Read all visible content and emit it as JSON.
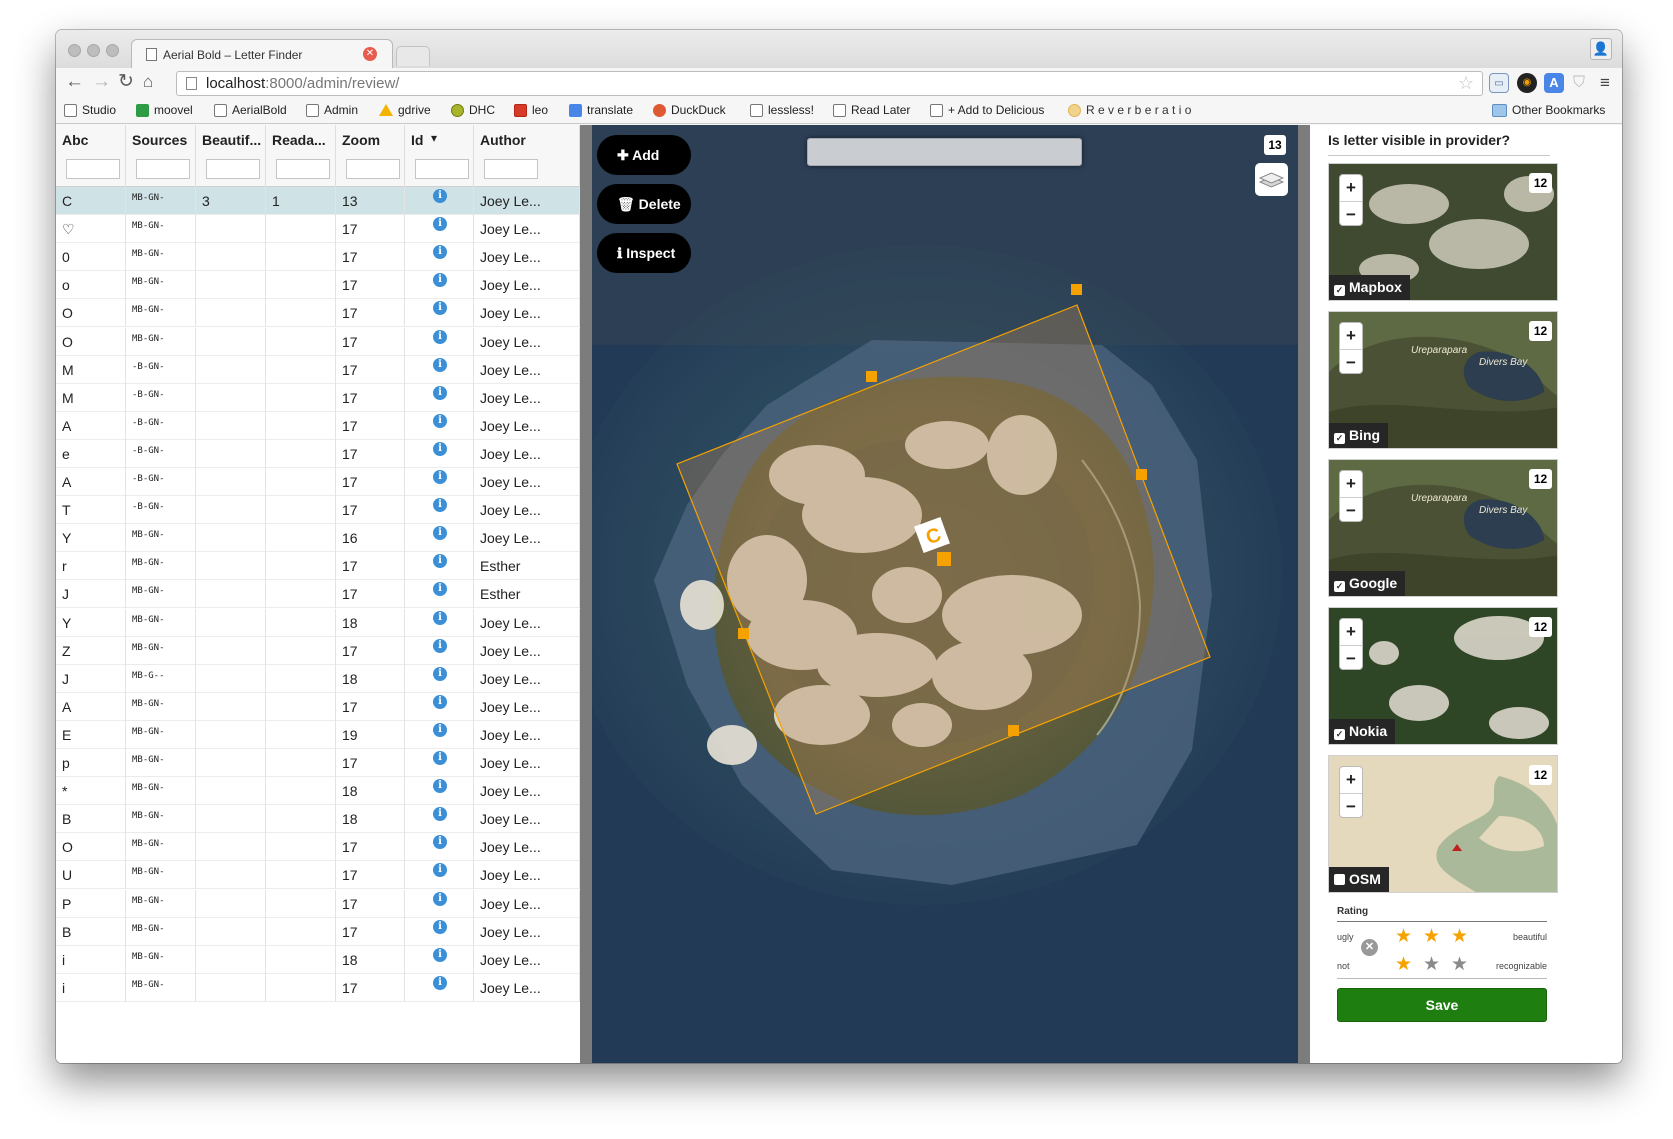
{
  "browser": {
    "tab_title": "Aerial Bold – Letter Finder",
    "url_host": "localhost",
    "url_rest": ":8000/admin/review/",
    "bookmarks": [
      "Studio",
      "moovel",
      "AerialBold",
      "Admin",
      "gdrive",
      "DHC",
      "leo",
      "translate",
      "DuckDuck",
      "lessless!",
      "Read Later",
      "+ Add to Delicious",
      "R e v e r b e r a t i o"
    ],
    "other_bookmarks": "Other Bookmarks"
  },
  "table": {
    "columns": [
      "Abc",
      "Sources",
      "Beautif...",
      "Reada...",
      "Zoom",
      "Id",
      "Author"
    ],
    "rows": [
      {
        "abc": "C",
        "src": "MB-GN-",
        "beautiful": "3",
        "readable": "1",
        "zoom": "13",
        "author": "Joey Le..."
      },
      {
        "abc": "♡",
        "src": "MB-GN-",
        "beautiful": "",
        "readable": "",
        "zoom": "17",
        "author": "Joey Le..."
      },
      {
        "abc": "0",
        "src": "MB-GN-",
        "beautiful": "",
        "readable": "",
        "zoom": "17",
        "author": "Joey Le..."
      },
      {
        "abc": "o",
        "src": "MB-GN-",
        "beautiful": "",
        "readable": "",
        "zoom": "17",
        "author": "Joey Le..."
      },
      {
        "abc": "O",
        "src": "MB-GN-",
        "beautiful": "",
        "readable": "",
        "zoom": "17",
        "author": "Joey Le..."
      },
      {
        "abc": "O",
        "src": "MB-GN-",
        "beautiful": "",
        "readable": "",
        "zoom": "17",
        "author": "Joey Le..."
      },
      {
        "abc": "M",
        "src": "-B-GN-",
        "beautiful": "",
        "readable": "",
        "zoom": "17",
        "author": "Joey Le..."
      },
      {
        "abc": "M",
        "src": "-B-GN-",
        "beautiful": "",
        "readable": "",
        "zoom": "17",
        "author": "Joey Le..."
      },
      {
        "abc": "A",
        "src": "-B-GN-",
        "beautiful": "",
        "readable": "",
        "zoom": "17",
        "author": "Joey Le..."
      },
      {
        "abc": "e",
        "src": "-B-GN-",
        "beautiful": "",
        "readable": "",
        "zoom": "17",
        "author": "Joey Le..."
      },
      {
        "abc": "A",
        "src": "-B-GN-",
        "beautiful": "",
        "readable": "",
        "zoom": "17",
        "author": "Joey Le..."
      },
      {
        "abc": "T",
        "src": "-B-GN-",
        "beautiful": "",
        "readable": "",
        "zoom": "17",
        "author": "Joey Le..."
      },
      {
        "abc": "Y",
        "src": "MB-GN-",
        "beautiful": "",
        "readable": "",
        "zoom": "16",
        "author": "Joey Le..."
      },
      {
        "abc": "r",
        "src": "MB-GN-",
        "beautiful": "",
        "readable": "",
        "zoom": "17",
        "author": "Esther"
      },
      {
        "abc": "J",
        "src": "MB-GN-",
        "beautiful": "",
        "readable": "",
        "zoom": "17",
        "author": "Esther"
      },
      {
        "abc": "Y",
        "src": "MB-GN-",
        "beautiful": "",
        "readable": "",
        "zoom": "18",
        "author": "Joey Le..."
      },
      {
        "abc": "Z",
        "src": "MB-GN-",
        "beautiful": "",
        "readable": "",
        "zoom": "17",
        "author": "Joey Le..."
      },
      {
        "abc": "J",
        "src": "MB-G--",
        "beautiful": "",
        "readable": "",
        "zoom": "18",
        "author": "Joey Le..."
      },
      {
        "abc": "A",
        "src": "MB-GN-",
        "beautiful": "",
        "readable": "",
        "zoom": "17",
        "author": "Joey Le..."
      },
      {
        "abc": "E",
        "src": "MB-GN-",
        "beautiful": "",
        "readable": "",
        "zoom": "19",
        "author": "Joey Le..."
      },
      {
        "abc": "p",
        "src": "MB-GN-",
        "beautiful": "",
        "readable": "",
        "zoom": "17",
        "author": "Joey Le..."
      },
      {
        "abc": "*",
        "src": "MB-GN-",
        "beautiful": "",
        "readable": "",
        "zoom": "18",
        "author": "Joey Le..."
      },
      {
        "abc": "B",
        "src": "MB-GN-",
        "beautiful": "",
        "readable": "",
        "zoom": "18",
        "author": "Joey Le..."
      },
      {
        "abc": "O",
        "src": "MB-GN-",
        "beautiful": "",
        "readable": "",
        "zoom": "17",
        "author": "Joey Le..."
      },
      {
        "abc": "U",
        "src": "MB-GN-",
        "beautiful": "",
        "readable": "",
        "zoom": "17",
        "author": "Joey Le..."
      },
      {
        "abc": "P",
        "src": "MB-GN-",
        "beautiful": "",
        "readable": "",
        "zoom": "17",
        "author": "Joey Le..."
      },
      {
        "abc": "B",
        "src": "MB-GN-",
        "beautiful": "",
        "readable": "",
        "zoom": "17",
        "author": "Joey Le..."
      },
      {
        "abc": "i",
        "src": "MB-GN-",
        "beautiful": "",
        "readable": "",
        "zoom": "18",
        "author": "Joey Le..."
      },
      {
        "abc": "i",
        "src": "MB-GN-",
        "beautiful": "",
        "readable": "",
        "zoom": "17",
        "author": "Joey Le..."
      }
    ]
  },
  "map": {
    "add_label": "Add",
    "delete_label": "Delete",
    "inspect_label": "Inspect",
    "zoom_level": "13",
    "letter": "C",
    "accent": "#f5a200"
  },
  "panel": {
    "title": "Is letter visible in provider?",
    "providers": [
      {
        "name": "Mapbox",
        "zoom": "12",
        "checked": true,
        "labels": []
      },
      {
        "name": "Bing",
        "zoom": "12",
        "checked": true,
        "labels": [
          "Ureparapara",
          "Divers Bay"
        ]
      },
      {
        "name": "Google",
        "zoom": "12",
        "checked": true,
        "labels": [
          "Ureparapara",
          "Divers Bay"
        ]
      },
      {
        "name": "Nokia",
        "zoom": "12",
        "checked": true,
        "labels": []
      },
      {
        "name": "OSM",
        "zoom": "12",
        "checked": false,
        "labels": []
      }
    ],
    "rating_title": "Rating",
    "beauty": {
      "low": "ugly",
      "high": "beautiful",
      "value": 3,
      "max": 3
    },
    "readability": {
      "low": "not",
      "high": "recognizable",
      "value": 1,
      "max": 3
    },
    "save_label": "Save",
    "save_color": "#1e7e0f"
  }
}
